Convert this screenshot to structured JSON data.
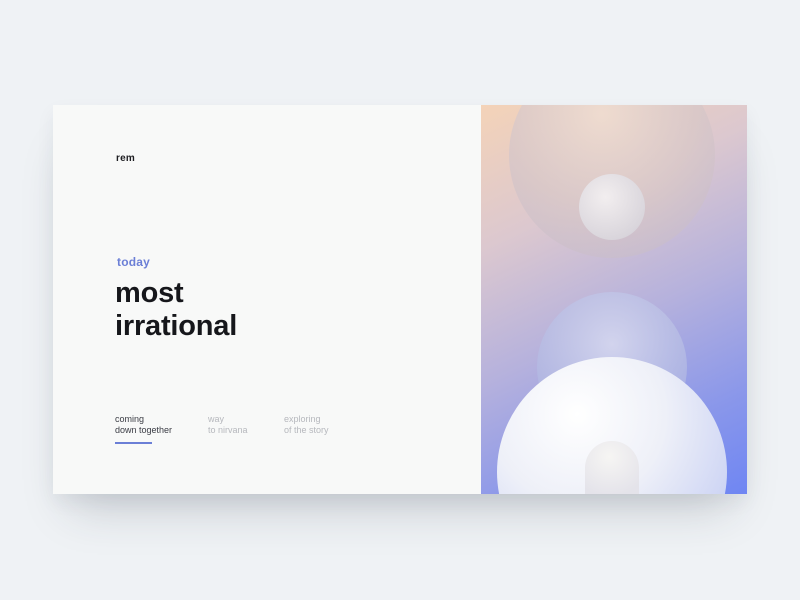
{
  "brand": {
    "logo_text": "rem"
  },
  "hero": {
    "eyebrow": "today",
    "title_line1": "most",
    "title_line2": "irrational"
  },
  "nav": {
    "items": [
      {
        "line1": "coming",
        "line2": "down together",
        "active": true
      },
      {
        "line1": "way",
        "line2": "to nirvana",
        "active": false
      },
      {
        "line1": "exploring",
        "line2": "of the story",
        "active": false
      }
    ]
  },
  "colors": {
    "accent": "#6b7fd6",
    "heading": "#16171b",
    "muted_text": "#b6b8bd",
    "page_background": "#eff2f5",
    "panel_background": "#f8f9f8",
    "gradient_warm": "#f4d3b8",
    "gradient_cool": "#6f86f3"
  }
}
